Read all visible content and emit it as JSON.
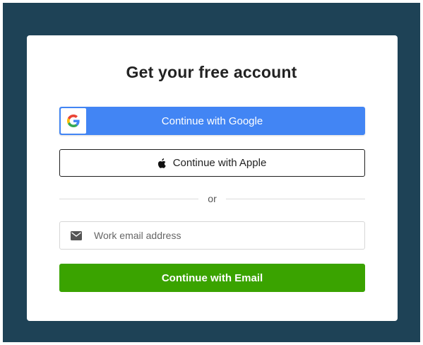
{
  "colors": {
    "backdrop": "#1e4256",
    "google_blue": "#4285f4",
    "email_green": "#3aa300"
  },
  "signup": {
    "title": "Get your free account",
    "google": {
      "label": "Continue with Google",
      "icon": "google-logo-icon"
    },
    "apple": {
      "label": "Continue with Apple",
      "icon": "apple-logo-icon"
    },
    "divider_text": "or",
    "email": {
      "placeholder": "Work email address",
      "value": "",
      "icon": "mail-icon"
    },
    "submit_label": "Continue with Email"
  }
}
